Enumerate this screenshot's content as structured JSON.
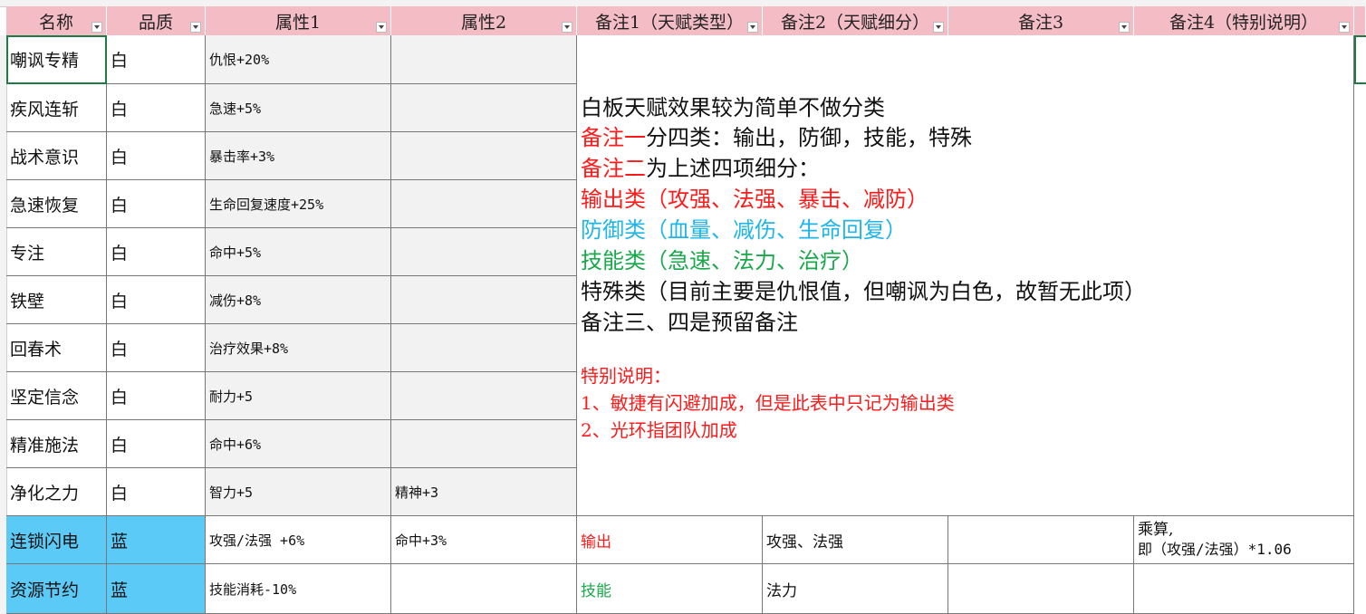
{
  "headers": [
    "名称",
    "品质",
    "属性1",
    "属性2",
    "备注1（天赋类型）",
    "备注2（天赋细分）",
    "备注3",
    "备注4（特别说明）"
  ],
  "rows": [
    {
      "name": "嘲讽专精",
      "quality": "白",
      "attr1": "仇恨+20%",
      "attr2": ""
    },
    {
      "name": "疾风连斩",
      "quality": "白",
      "attr1": "急速+5%",
      "attr2": ""
    },
    {
      "name": "战术意识",
      "quality": "白",
      "attr1": "暴击率+3%",
      "attr2": ""
    },
    {
      "name": "急速恢复",
      "quality": "白",
      "attr1": "生命回复速度+25%",
      "attr2": ""
    },
    {
      "name": "专注",
      "quality": "白",
      "attr1": "命中+5%",
      "attr2": ""
    },
    {
      "name": "铁壁",
      "quality": "白",
      "attr1": "减伤+8%",
      "attr2": ""
    },
    {
      "name": "回春术",
      "quality": "白",
      "attr1": "治疗效果+8%",
      "attr2": ""
    },
    {
      "name": "坚定信念",
      "quality": "白",
      "attr1": "耐力+5",
      "attr2": ""
    },
    {
      "name": "精准施法",
      "quality": "白",
      "attr1": "命中+6%",
      "attr2": ""
    },
    {
      "name": "净化之力",
      "quality": "白",
      "attr1": "智力+5",
      "attr2": "精神+3"
    }
  ],
  "blue_rows": [
    {
      "name": "连锁闪电",
      "quality": "蓝",
      "attr1": "攻强/法强 +6%",
      "attr2": "命中+3%",
      "note1": "输出",
      "note2": "攻强、法强",
      "note3": "",
      "note4_line1": "乘算,",
      "note4_line2": "即（攻强/法强）*1.06"
    },
    {
      "name": "资源节约",
      "quality": "蓝",
      "attr1": "技能消耗-10%",
      "attr2": "",
      "note1": "技能",
      "note2": "法力",
      "note3": "",
      "note4_line1": "",
      "note4_line2": ""
    }
  ],
  "notes": {
    "line1": "白板天赋效果较为简单不做分类",
    "line2_red": "备注一",
    "line2_rest": "分四类：输出，防御，技能，特殊",
    "line3_red": "备注二",
    "line3_rest": "为上述四项细分：",
    "line4": "输出类（攻强、法强、暴击、减防）",
    "line5": "防御类（血量、减伤、生命回复）",
    "line6": "技能类（急速、法力、治疗）",
    "line7": "特殊类（目前主要是仇恨值，但嘲讽为白色，故暂无此项）",
    "line8": "备注三、四是预留备注",
    "special_title": "特别说明：",
    "special_1": "1、敏捷有闪避加成，但是此表中只记为输出类",
    "special_2": "2、光环指团队加成"
  },
  "colors": {
    "header_bg": "#f4bcc5",
    "blue_cell": "#5ccaf7",
    "red": "#ff1a1a",
    "cyan": "#1fb5e6",
    "green": "#19a84a",
    "selection": "#1e7b45"
  }
}
